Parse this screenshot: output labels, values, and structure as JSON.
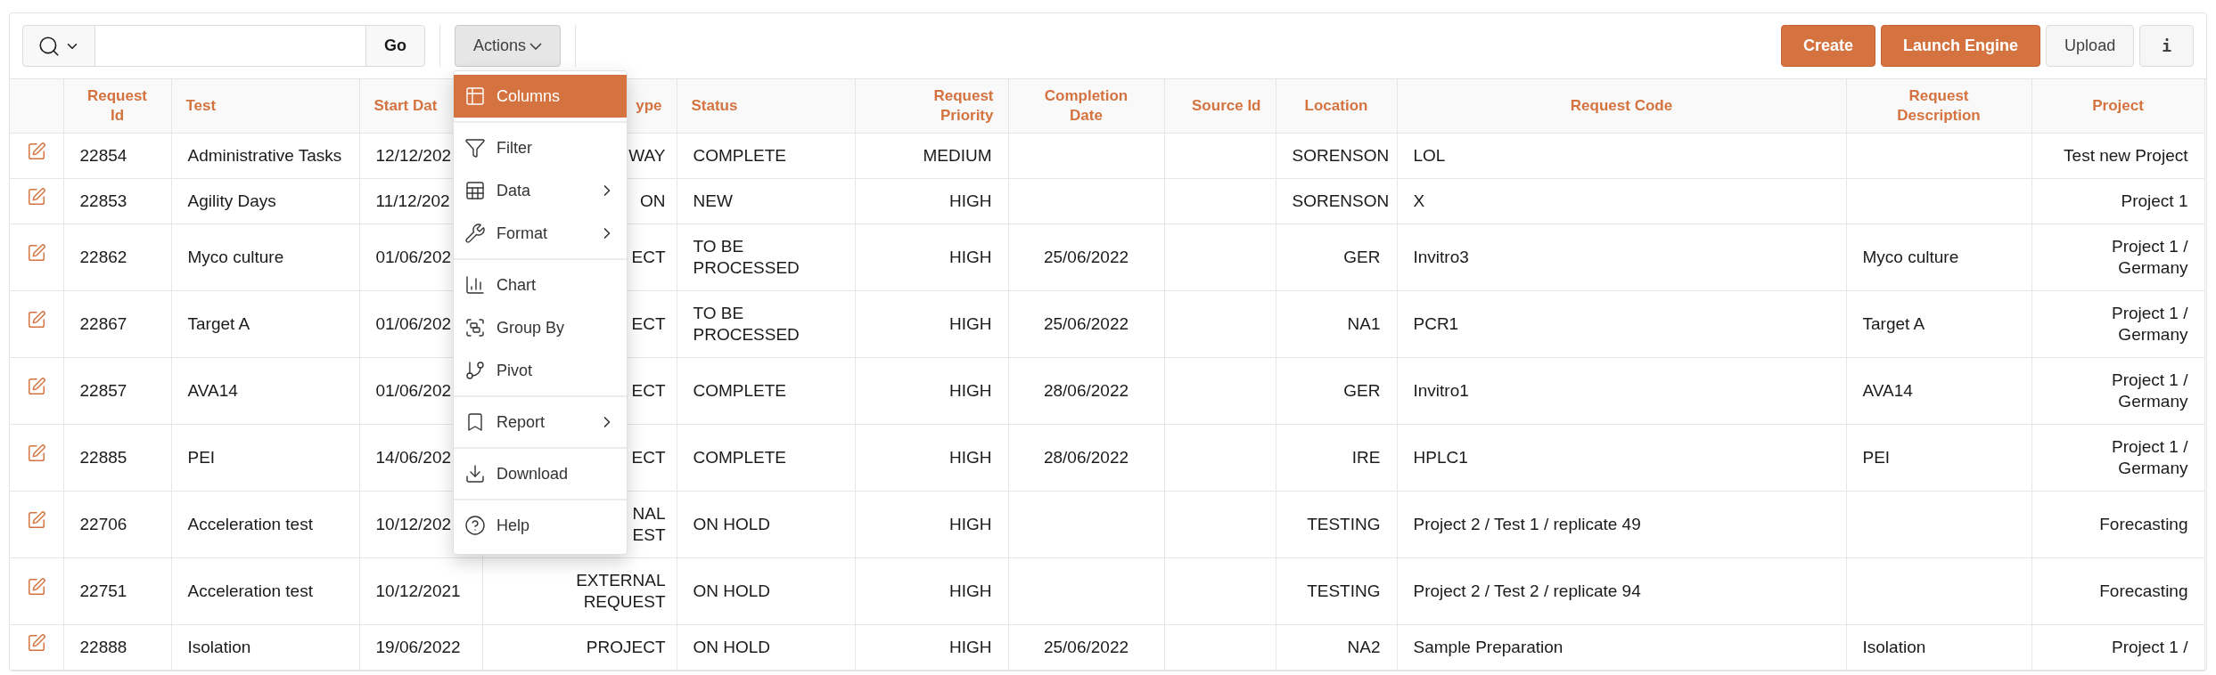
{
  "toolbar": {
    "go_label": "Go",
    "actions": {
      "label": "Actions",
      "expanded": true
    },
    "buttons": [
      {
        "label": "Create",
        "kind": "primary"
      },
      {
        "label": "Launch Engine",
        "kind": "primary"
      },
      {
        "label": "Upload",
        "kind": "secondary"
      },
      {
        "label": "i",
        "kind": "icon"
      }
    ]
  },
  "actions_menu": {
    "groups": [
      [
        {
          "label": "Columns",
          "has_submenu": false,
          "selected": true
        }
      ],
      [
        {
          "label": "Filter",
          "has_submenu": false,
          "selected": false
        },
        {
          "label": "Data",
          "has_submenu": true,
          "selected": false
        },
        {
          "label": "Format",
          "has_submenu": true,
          "selected": false
        }
      ],
      [
        {
          "label": "Chart",
          "has_submenu": false,
          "selected": false
        },
        {
          "label": "Group By",
          "has_submenu": false,
          "selected": false
        },
        {
          "label": "Pivot",
          "has_submenu": false,
          "selected": false
        }
      ],
      [
        {
          "label": "Report",
          "has_submenu": true,
          "selected": false
        }
      ],
      [
        {
          "label": "Download",
          "has_submenu": false,
          "selected": false
        }
      ],
      [
        {
          "label": "Help",
          "has_submenu": false,
          "selected": false
        }
      ]
    ]
  },
  "table": {
    "columns": [
      {
        "label": "Request Id"
      },
      {
        "label": "Test"
      },
      {
        "label": "Start Dat"
      },
      {
        "label": "ype"
      },
      {
        "label": "Status"
      },
      {
        "label": "Request Priority"
      },
      {
        "label": "Completion Date"
      },
      {
        "label": "Source Id"
      },
      {
        "label": "Location"
      },
      {
        "label": "Request Code"
      },
      {
        "label": "Request Description"
      },
      {
        "label": "Project"
      }
    ],
    "rows": [
      {
        "cells": [
          "22854",
          "Administrative Tasks",
          "12/12/202",
          "WAY",
          "COMPLETE",
          "MEDIUM",
          null,
          null,
          "SORENSON",
          "LOL",
          null,
          "Test new Project"
        ]
      },
      {
        "cells": [
          "22853",
          "Agility Days",
          "11/12/202",
          "ON",
          "NEW",
          "HIGH",
          null,
          null,
          "SORENSON",
          "X",
          null,
          "Project 1"
        ]
      },
      {
        "cells": [
          "22862",
          "Myco culture",
          "01/06/202",
          "ECT",
          "TO BE PROCESSED",
          "HIGH",
          "25/06/2022",
          null,
          "GER",
          "Invitro3",
          "Myco culture",
          "Project 1 / Germany"
        ]
      },
      {
        "cells": [
          "22867",
          "Target A",
          "01/06/202",
          "ECT",
          "TO BE PROCESSED",
          "HIGH",
          "25/06/2022",
          null,
          "NA1",
          "PCR1",
          "Target A",
          "Project 1 / Germany"
        ]
      },
      {
        "cells": [
          "22857",
          "AVA14",
          "01/06/202",
          "ECT",
          "COMPLETE",
          "HIGH",
          "28/06/2022",
          null,
          "GER",
          "Invitro1",
          "AVA14",
          "Project 1 / Germany"
        ]
      },
      {
        "cells": [
          "22885",
          "PEI",
          "14/06/202",
          "ECT",
          "COMPLETE",
          "HIGH",
          "28/06/2022",
          null,
          "IRE",
          "HPLC1",
          "PEI",
          "Project 1 / Germany"
        ]
      },
      {
        "cells": [
          "22706",
          "Acceleration test",
          "10/12/202",
          "NAL\nEST",
          "ON HOLD",
          "HIGH",
          null,
          null,
          "TESTING",
          "Project 2 / Test 1 / replicate 49",
          null,
          "Forecasting"
        ]
      },
      {
        "cells": [
          "22751",
          "Acceleration test",
          "10/12/2021",
          "EXTERNAL REQUEST",
          "ON HOLD",
          "HIGH",
          null,
          null,
          "TESTING",
          "Project 2 / Test 2 / replicate 94",
          null,
          "Forecasting"
        ]
      },
      {
        "cells": [
          "22888",
          "Isolation",
          "19/06/2022",
          "PROJECT",
          "ON HOLD",
          "HIGH",
          "25/06/2022",
          null,
          "NA2",
          "Sample Preparation",
          "Isolation",
          "Project 1 /"
        ]
      }
    ]
  }
}
